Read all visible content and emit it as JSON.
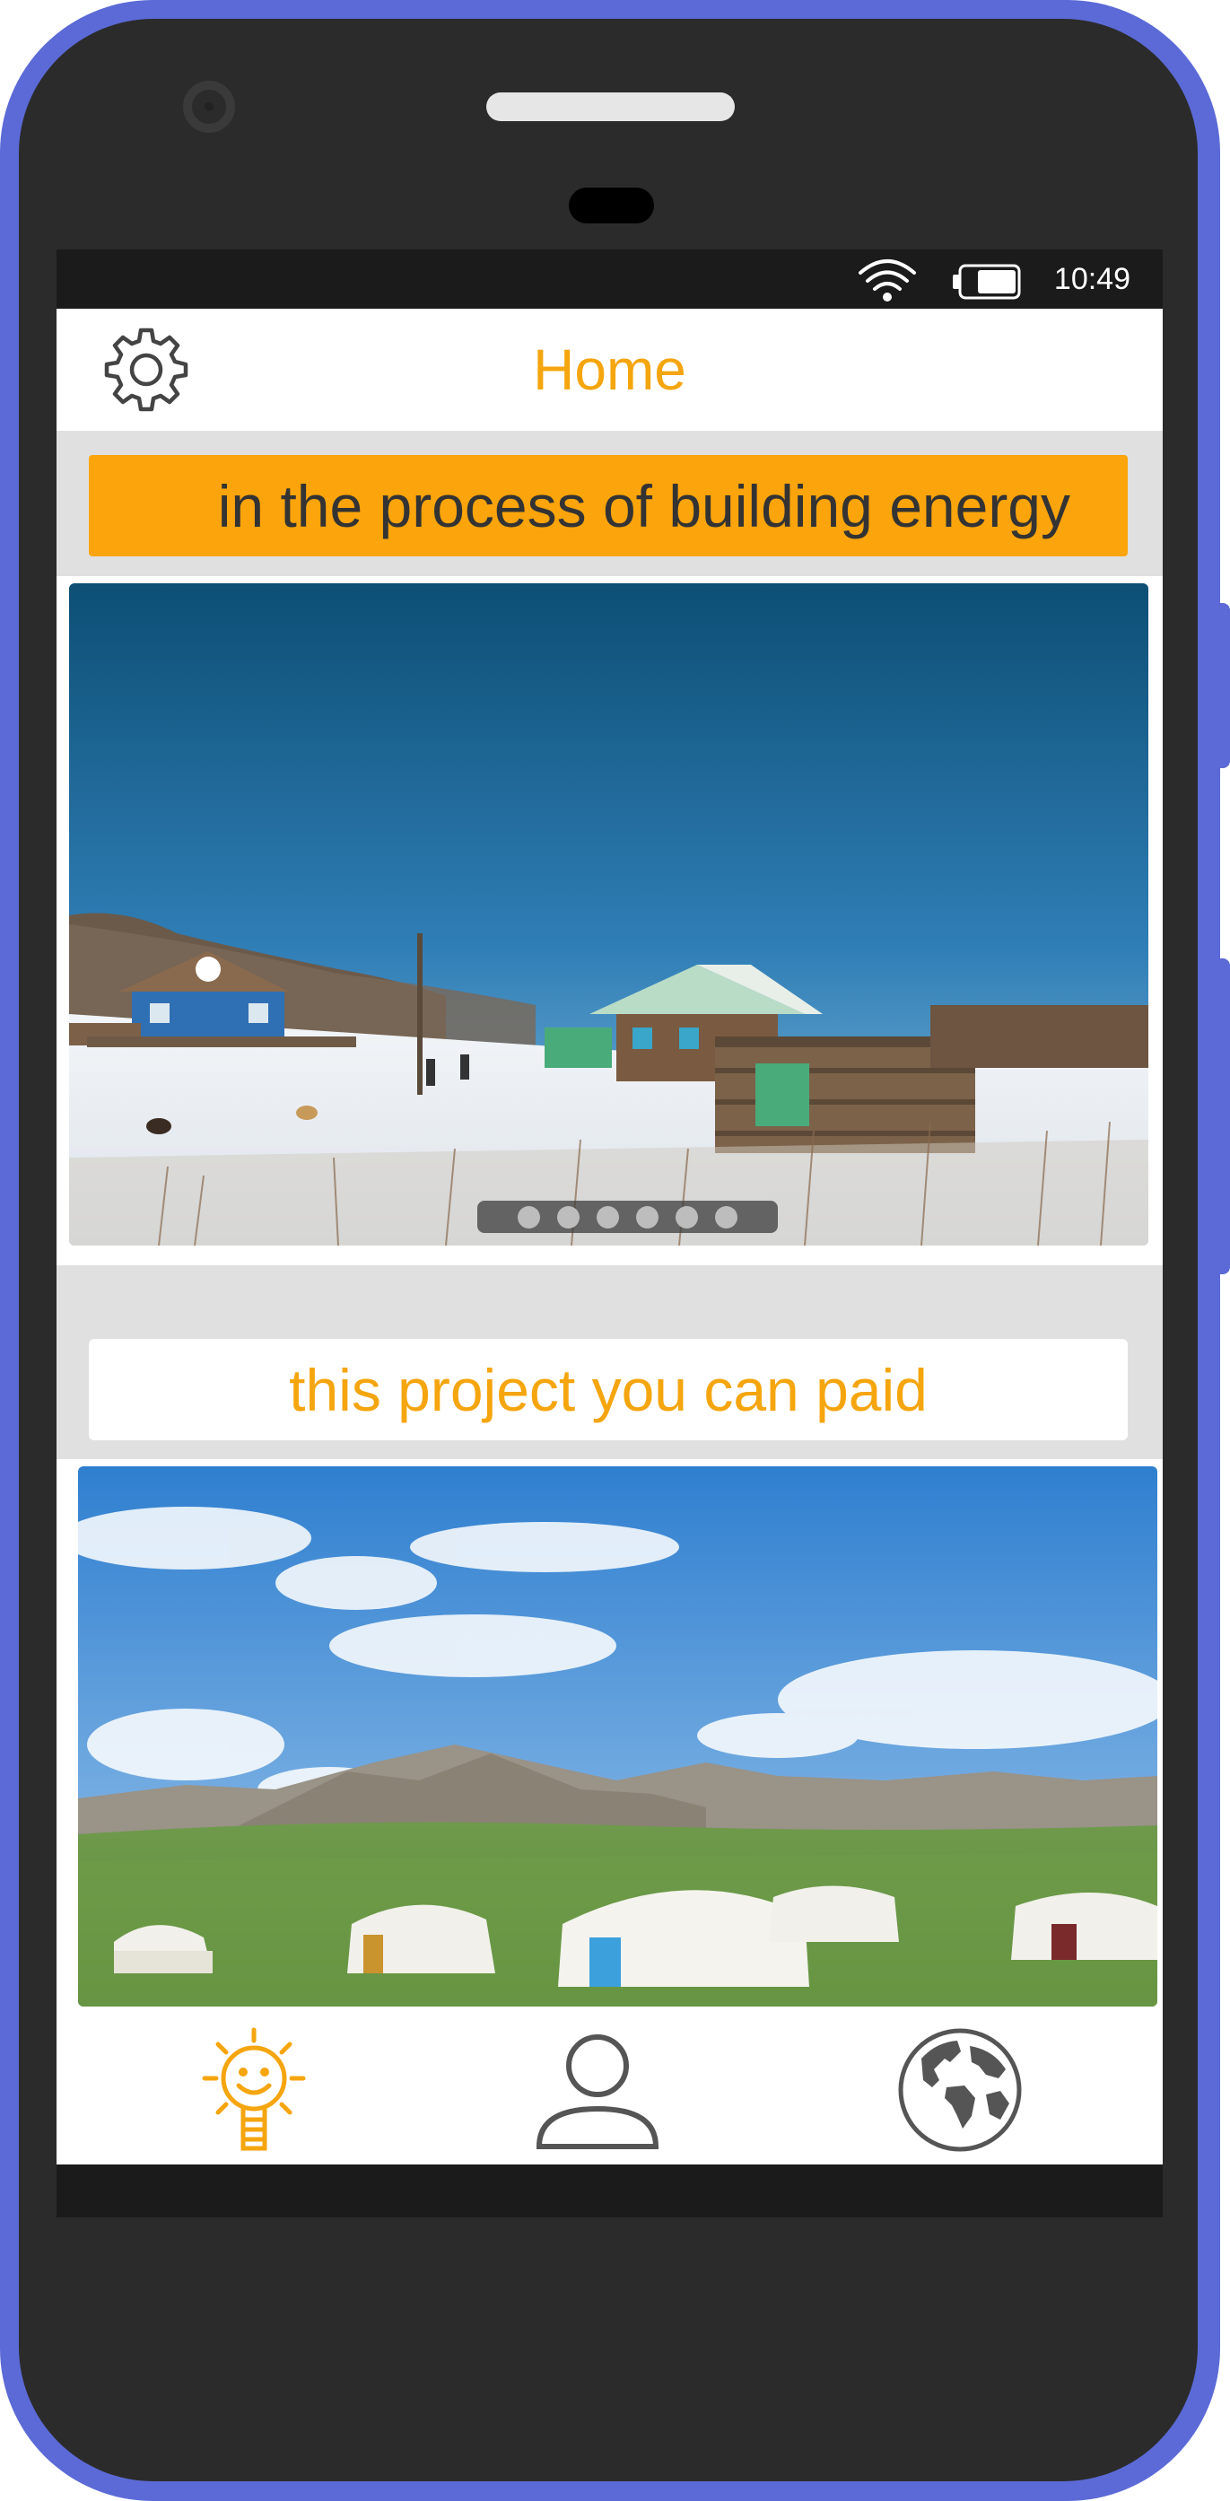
{
  "status_bar": {
    "time": "10:49",
    "icons": [
      "wifi-icon",
      "battery-icon"
    ]
  },
  "app_bar": {
    "title": "Home",
    "settings_icon": "gear-icon"
  },
  "sections": {
    "building_banner": "in the process of building energy",
    "paid_banner": "this project you can paid"
  },
  "carousel": {
    "slide_count": 6,
    "active_index": 0
  },
  "bottom_nav": {
    "items": [
      "sun-lightbulb-icon",
      "user-icon",
      "globe-icon"
    ],
    "active": "sun-lightbulb-icon"
  },
  "colors": {
    "accent": "#f5a50e",
    "banner_bg": "#fba40b",
    "banner_text": "#333333",
    "frame": "#5b6ad6",
    "icon_gray": "#555555"
  }
}
